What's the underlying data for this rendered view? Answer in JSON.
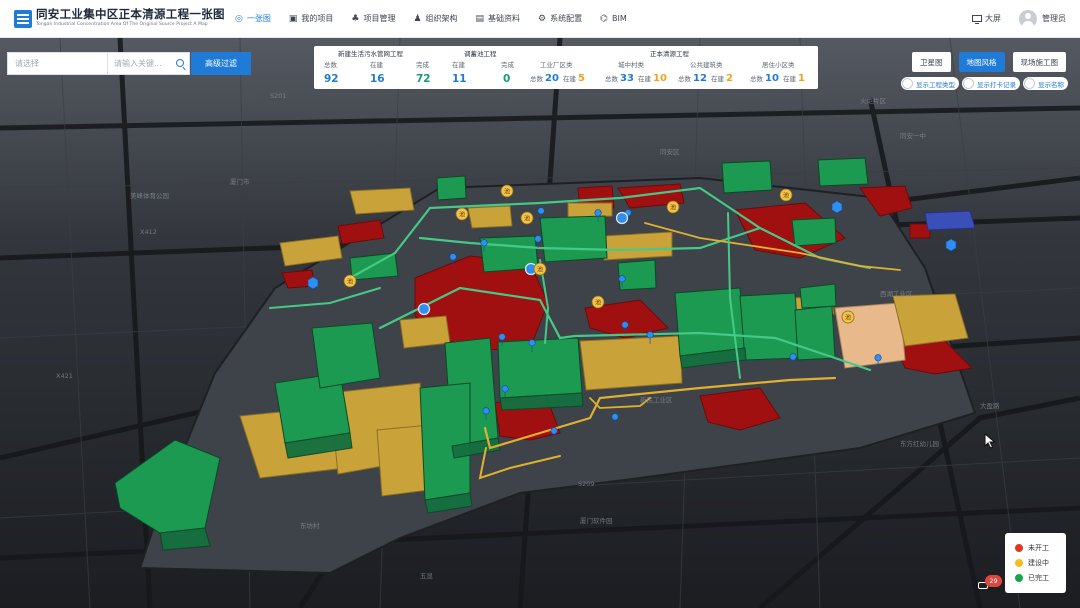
{
  "app": {
    "title": "同安工业集中区正本清源工程一张图",
    "subtitle": "Tongan Industrial Concentration Area Of The Original Source Project A Map"
  },
  "nav": [
    {
      "label": "一张图",
      "icon": "globe-icon",
      "active": true
    },
    {
      "label": "我的项目",
      "icon": "folder-icon",
      "active": false
    },
    {
      "label": "项目管理",
      "icon": "org-icon",
      "active": false
    },
    {
      "label": "组织架构",
      "icon": "people-icon",
      "active": false
    },
    {
      "label": "基础资料",
      "icon": "database-icon",
      "active": false
    },
    {
      "label": "系统配置",
      "icon": "gear-icon",
      "active": false
    },
    {
      "label": "BIM",
      "icon": "bim-icon",
      "active": false
    }
  ],
  "header_right": {
    "bigscreen": "大屏",
    "user": "管理员"
  },
  "filter": {
    "select_placeholder": "请选择",
    "search_placeholder": "请输入关键...",
    "button": "高级过滤"
  },
  "stats": {
    "groups": [
      {
        "title": "新建生活污水管网工程",
        "columns": [
          {
            "label": "总数",
            "value": "92",
            "color": "#1f7bd8"
          },
          {
            "label": "在建",
            "value": "16",
            "color": "#1f7bd8"
          },
          {
            "label": "完成",
            "value": "72",
            "color": "#14a06a"
          }
        ]
      },
      {
        "title": "调蓄池工程",
        "columns": [
          {
            "label": "在建",
            "value": "11",
            "color": "#1f7bd8"
          },
          {
            "label": "完成",
            "value": "0",
            "color": "#14a06a"
          }
        ]
      },
      {
        "title": "正本清源工程",
        "categories": [
          {
            "name": "工业厂区类",
            "total_label": "总数",
            "total": "20",
            "building_label": "在建",
            "building": "5"
          },
          {
            "name": "城中村类",
            "total_label": "总数",
            "total": "33",
            "building_label": "在建",
            "building": "10"
          },
          {
            "name": "公共建筑类",
            "total_label": "总数",
            "total": "12",
            "building_label": "在建",
            "building": "2"
          },
          {
            "name": "居住小区类",
            "total_label": "总数",
            "total": "10",
            "building_label": "在建",
            "building": "1"
          }
        ]
      }
    ]
  },
  "map_style": {
    "buttons": [
      "卫星图",
      "地图风格",
      "现场施工图"
    ],
    "active": "地图风格"
  },
  "toggles": [
    "显示工程类型",
    "显示打卡记录",
    "显示名称"
  ],
  "legend": [
    {
      "label": "未开工",
      "color": "#e03a1e"
    },
    {
      "label": "建设中",
      "color": "#f0c020"
    },
    {
      "label": "已完工",
      "color": "#14a64a"
    }
  ],
  "notification_count": "29",
  "map_labels": [
    "厦门市",
    "同安区",
    "美峰体育公园",
    "西湖工业区",
    "X421",
    "X412",
    "S209",
    "大盈路",
    "火炬片区",
    "厦门软件园",
    "东方红幼儿园",
    "同安一中",
    "新民工业区",
    "东坊村",
    "五显",
    "S201"
  ],
  "pool_marker_text": "池"
}
